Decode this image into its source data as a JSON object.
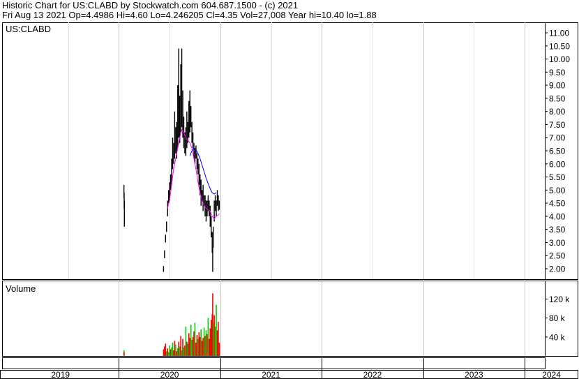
{
  "header": {
    "line1": "Historic Chart for US:CLABD by Stockwatch.com 604.687.1500 - (c) 2021",
    "line2": "Fri Aug 13 2021   Op=4.4986   Hi=4.60   Lo=4.246205   Cl=4.35   Vol=27,008   Year hi=10.40   lo=1.88"
  },
  "chart_data": [
    {
      "type": "line",
      "title": "US:CLABD",
      "ylim": [
        1.6,
        11.4
      ],
      "y_ticks": [
        "11.00",
        "10.50",
        "10.00",
        "9.50",
        "9.00",
        "8.50",
        "8.00",
        "7.50",
        "7.00",
        "6.50",
        "6.00",
        "5.50",
        "5.00",
        "4.50",
        "4.00",
        "3.50",
        "3.00",
        "2.50",
        "2.00"
      ],
      "x_range": [
        2019.0,
        2024.35
      ],
      "x_ticks": [
        "2019",
        "2020",
        "2021",
        "2022",
        "2023",
        "2024"
      ],
      "grid": true,
      "colors": {
        "price": "#000000",
        "ma_short": "#ff00ff",
        "ma_long": "#0000ff"
      },
      "series": [
        {
          "values": [
            [
              2020.05,
              4.7,
              5.2
            ],
            [
              2020.052,
              4.3,
              4.9
            ],
            [
              2020.054,
              3.6,
              4.6
            ],
            [
              2020.44,
              1.88,
              2.1
            ],
            [
              2020.45,
              2.4,
              2.7
            ],
            [
              2020.46,
              3.0,
              3.3
            ],
            [
              2020.47,
              3.4,
              3.8
            ],
            [
              2020.48,
              4.0,
              4.6
            ],
            [
              2020.49,
              4.5,
              5.0
            ],
            [
              2020.5,
              4.6,
              5.3
            ],
            [
              2020.51,
              5.0,
              5.6
            ],
            [
              2020.52,
              5.2,
              6.2
            ],
            [
              2020.53,
              5.8,
              7.0
            ],
            [
              2020.54,
              6.0,
              6.8
            ],
            [
              2020.55,
              6.2,
              8.0
            ],
            [
              2020.56,
              6.4,
              7.4
            ],
            [
              2020.57,
              6.2,
              7.6
            ],
            [
              2020.58,
              6.6,
              9.0
            ],
            [
              2020.59,
              7.0,
              10.4
            ],
            [
              2020.6,
              6.8,
              8.6
            ],
            [
              2020.61,
              7.2,
              9.8
            ],
            [
              2020.62,
              7.4,
              10.4
            ],
            [
              2020.63,
              7.0,
              8.8
            ],
            [
              2020.64,
              6.6,
              7.8
            ],
            [
              2020.65,
              6.4,
              7.2
            ],
            [
              2020.66,
              6.3,
              7.4
            ],
            [
              2020.67,
              6.6,
              8.0
            ],
            [
              2020.68,
              6.8,
              7.6
            ],
            [
              2020.69,
              7.0,
              8.4
            ],
            [
              2020.7,
              7.2,
              8.8
            ],
            [
              2020.71,
              7.4,
              8.2
            ],
            [
              2020.72,
              6.8,
              7.6
            ],
            [
              2020.73,
              6.6,
              7.2
            ],
            [
              2020.74,
              6.2,
              6.8
            ],
            [
              2020.75,
              6.0,
              6.6
            ],
            [
              2020.76,
              6.2,
              6.7
            ],
            [
              2020.77,
              5.8,
              6.4
            ],
            [
              2020.78,
              5.6,
              6.2
            ],
            [
              2020.79,
              5.2,
              6.0
            ],
            [
              2020.8,
              4.8,
              5.6
            ],
            [
              2020.81,
              4.4,
              5.4
            ],
            [
              2020.82,
              4.6,
              5.0
            ],
            [
              2020.83,
              4.2,
              5.2
            ],
            [
              2020.84,
              4.4,
              4.8
            ],
            [
              2020.85,
              4.0,
              4.8
            ],
            [
              2020.86,
              3.8,
              4.6
            ],
            [
              2020.87,
              4.0,
              4.6
            ],
            [
              2020.88,
              4.2,
              4.8
            ],
            [
              2020.89,
              4.0,
              4.6
            ],
            [
              2020.9,
              3.6,
              4.4
            ],
            [
              2020.91,
              3.2,
              4.0
            ],
            [
              2020.92,
              2.6,
              3.4
            ],
            [
              2020.925,
              1.88,
              2.8
            ],
            [
              2020.93,
              2.8,
              3.6
            ],
            [
              2020.94,
              3.8,
              4.6
            ],
            [
              2020.95,
              4.2,
              4.8
            ],
            [
              2020.96,
              4.0,
              4.6
            ],
            [
              2020.97,
              4.4,
              5.0
            ],
            [
              2020.98,
              4.2,
              4.8
            ],
            [
              2020.99,
              4.25,
              4.6
            ]
          ]
        },
        {
          "values": [
            [
              2020.48,
              4.3
            ],
            [
              2020.5,
              4.6
            ],
            [
              2020.52,
              5.2
            ],
            [
              2020.54,
              5.8
            ],
            [
              2020.56,
              6.2
            ],
            [
              2020.58,
              6.6
            ],
            [
              2020.6,
              7.0
            ],
            [
              2020.62,
              7.3
            ],
            [
              2020.64,
              7.2
            ],
            [
              2020.66,
              7.0
            ],
            [
              2020.68,
              6.9
            ],
            [
              2020.7,
              6.8
            ],
            [
              2020.72,
              6.6
            ],
            [
              2020.74,
              6.2
            ],
            [
              2020.76,
              5.8
            ],
            [
              2020.78,
              5.3
            ],
            [
              2020.8,
              4.9
            ],
            [
              2020.82,
              4.6
            ],
            [
              2020.84,
              4.4
            ],
            [
              2020.86,
              4.3
            ],
            [
              2020.88,
              4.25
            ],
            [
              2020.9,
              4.2
            ],
            [
              2020.92,
              4.0
            ],
            [
              2020.94,
              3.9
            ],
            [
              2020.96,
              4.0
            ],
            [
              2020.98,
              4.05
            ],
            [
              2020.99,
              4.1
            ]
          ]
        },
        {
          "values": [
            [
              2020.7,
              6.3
            ],
            [
              2020.72,
              6.5
            ],
            [
              2020.74,
              6.6
            ],
            [
              2020.76,
              6.55
            ],
            [
              2020.78,
              6.4
            ],
            [
              2020.8,
              6.2
            ],
            [
              2020.82,
              5.95
            ],
            [
              2020.84,
              5.7
            ],
            [
              2020.86,
              5.45
            ],
            [
              2020.88,
              5.25
            ],
            [
              2020.9,
              5.05
            ],
            [
              2020.92,
              4.9
            ],
            [
              2020.94,
              4.85
            ],
            [
              2020.96,
              4.9
            ]
          ]
        }
      ]
    },
    {
      "type": "bar",
      "title": "Volume",
      "ylim": [
        0,
        150000
      ],
      "y_ticks": [
        "120 k",
        "80 k",
        "40 k"
      ],
      "colors": {
        "up": "#00cc00",
        "down": "#ff0000"
      },
      "series": [
        {
          "values": [
            [
              2020.05,
              12000,
              "up"
            ],
            [
              2020.052,
              8000,
              "down"
            ],
            [
              2020.44,
              14000,
              "down"
            ],
            [
              2020.45,
              20000,
              "down"
            ],
            [
              2020.46,
              26000,
              "down"
            ],
            [
              2020.47,
              10000,
              "up"
            ],
            [
              2020.48,
              16000,
              "down"
            ],
            [
              2020.49,
              8000,
              "up"
            ],
            [
              2020.5,
              22000,
              "up"
            ],
            [
              2020.51,
              14000,
              "down"
            ],
            [
              2020.52,
              18000,
              "up"
            ],
            [
              2020.53,
              28000,
              "up"
            ],
            [
              2020.54,
              12000,
              "down"
            ],
            [
              2020.55,
              32000,
              "down"
            ],
            [
              2020.56,
              24000,
              "up"
            ],
            [
              2020.57,
              10000,
              "down"
            ],
            [
              2020.58,
              16000,
              "up"
            ],
            [
              2020.59,
              30000,
              "down"
            ],
            [
              2020.6,
              20000,
              "up"
            ],
            [
              2020.61,
              42000,
              "down"
            ],
            [
              2020.62,
              12000,
              "up"
            ],
            [
              2020.63,
              36000,
              "down"
            ],
            [
              2020.64,
              18000,
              "up"
            ],
            [
              2020.65,
              22000,
              "down"
            ],
            [
              2020.66,
              62000,
              "up"
            ],
            [
              2020.67,
              30000,
              "down"
            ],
            [
              2020.68,
              26000,
              "up"
            ],
            [
              2020.69,
              48000,
              "down"
            ],
            [
              2020.7,
              38000,
              "down"
            ],
            [
              2020.71,
              66000,
              "up"
            ],
            [
              2020.72,
              34000,
              "up"
            ],
            [
              2020.73,
              40000,
              "down"
            ],
            [
              2020.74,
              52000,
              "down"
            ],
            [
              2020.75,
              70000,
              "up"
            ],
            [
              2020.76,
              28000,
              "down"
            ],
            [
              2020.77,
              44000,
              "down"
            ],
            [
              2020.78,
              36000,
              "up"
            ],
            [
              2020.79,
              50000,
              "down"
            ],
            [
              2020.8,
              40000,
              "down"
            ],
            [
              2020.81,
              56000,
              "up"
            ],
            [
              2020.82,
              32000,
              "down"
            ],
            [
              2020.83,
              38000,
              "down"
            ],
            [
              2020.84,
              60000,
              "up"
            ],
            [
              2020.85,
              42000,
              "down"
            ],
            [
              2020.86,
              54000,
              "up"
            ],
            [
              2020.87,
              46000,
              "down"
            ],
            [
              2020.88,
              80000,
              "up"
            ],
            [
              2020.89,
              36000,
              "down"
            ],
            [
              2020.9,
              58000,
              "down"
            ],
            [
              2020.91,
              76000,
              "down"
            ],
            [
              2020.92,
              88000,
              "down"
            ],
            [
              2020.925,
              132000,
              "down"
            ],
            [
              2020.93,
              70000,
              "up"
            ],
            [
              2020.94,
              86000,
              "down"
            ],
            [
              2020.95,
              62000,
              "up"
            ],
            [
              2020.96,
              108000,
              "up"
            ],
            [
              2020.97,
              54000,
              "down"
            ],
            [
              2020.98,
              72000,
              "down"
            ],
            [
              2020.99,
              28000,
              "down"
            ]
          ]
        }
      ]
    }
  ]
}
